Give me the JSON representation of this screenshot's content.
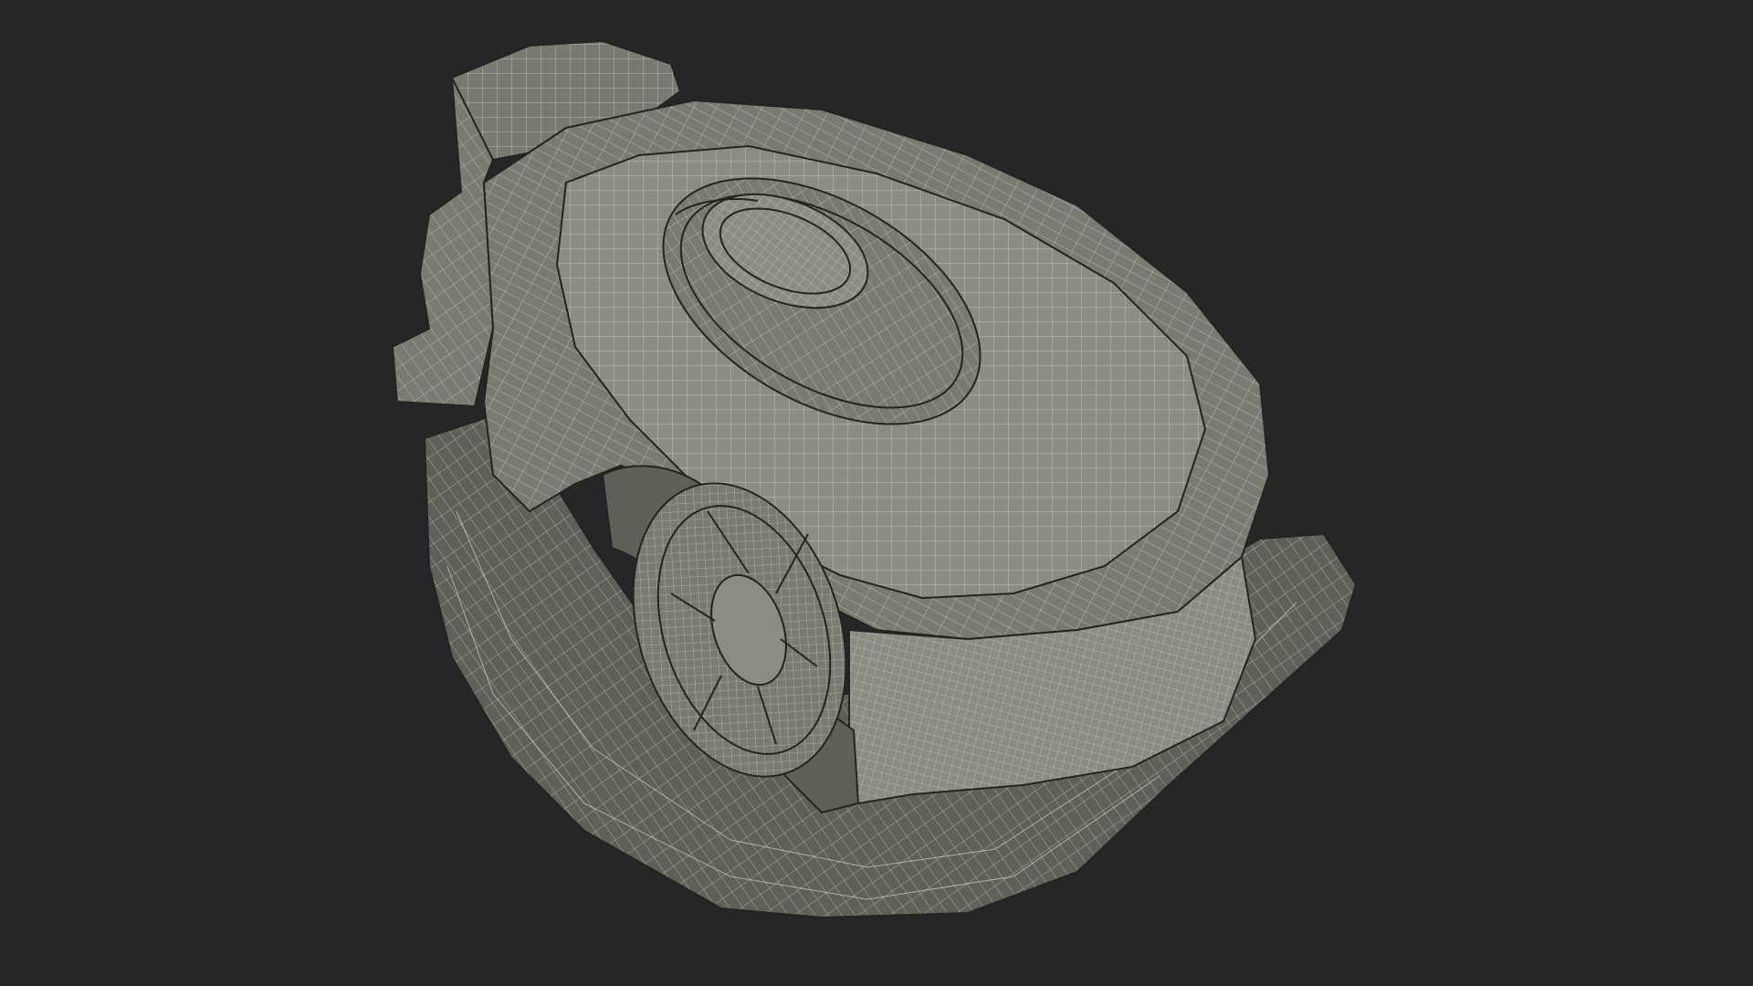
{
  "scene": {
    "subject_icon": "robotic-lawn-mower-wireframe-icon"
  },
  "colors": {
    "background": "#262626",
    "surface": "#7a7b70",
    "surface_light": "#8c8d82",
    "surface_dark": "#5f6057",
    "edge": "#23241f",
    "wire": "#e6e6da"
  }
}
